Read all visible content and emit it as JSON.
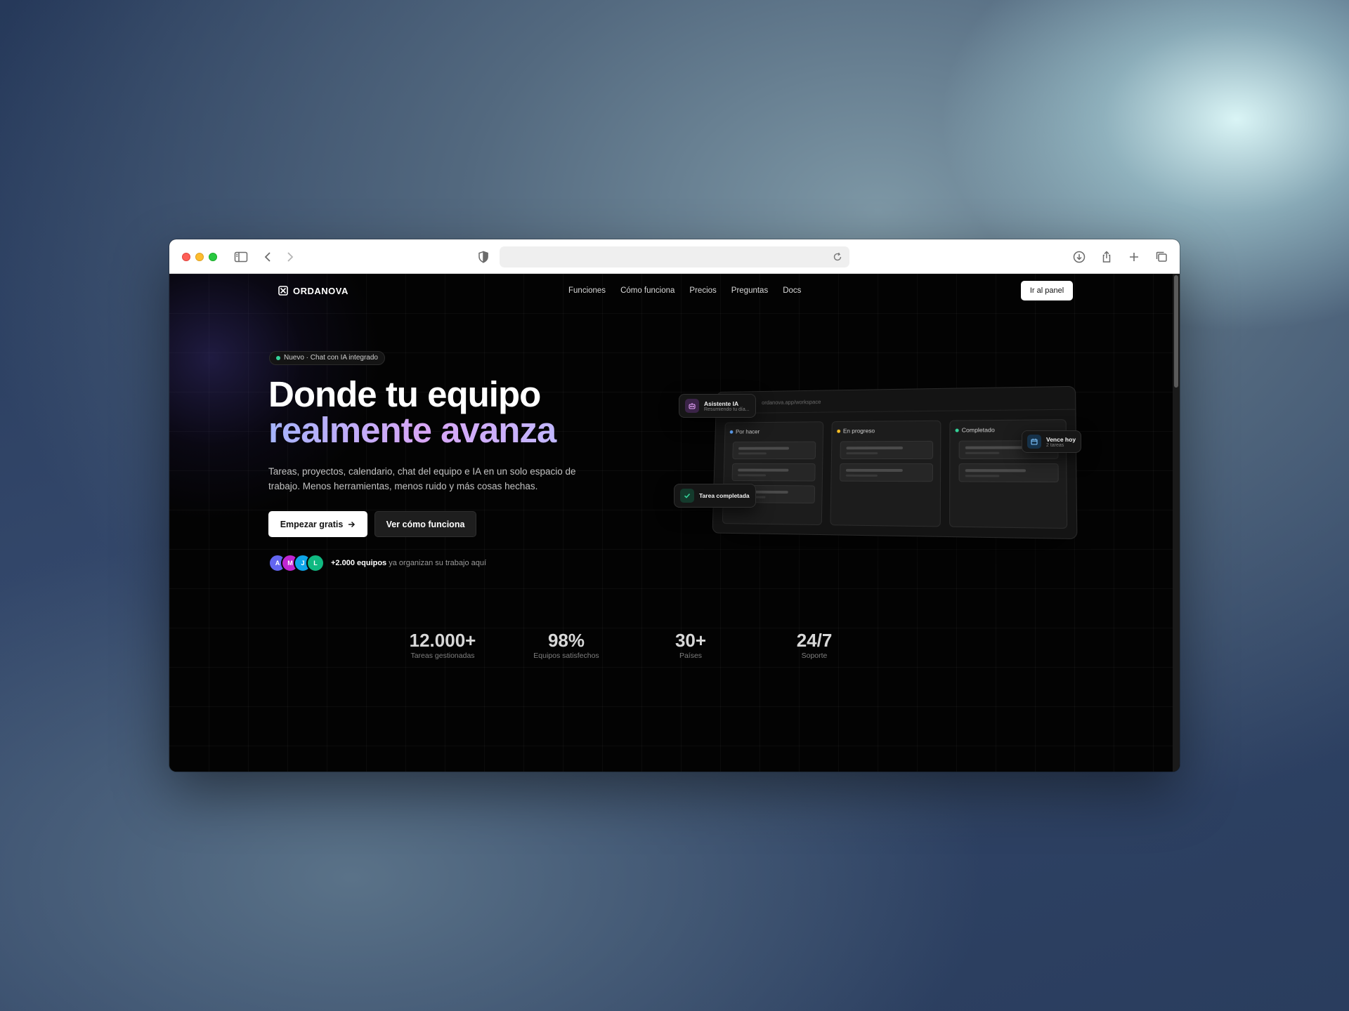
{
  "browser": {
    "url": "",
    "colors": {
      "close": "#fe5f57",
      "minimize": "#febc2e",
      "zoom": "#28c840"
    }
  },
  "nav": {
    "logo": "ORDANOVA",
    "links": [
      "Funciones",
      "Cómo funciona",
      "Precios",
      "Preguntas",
      "Docs"
    ],
    "cta": "Ir al panel"
  },
  "hero": {
    "badge": "Nuevo · Chat con IA integrado",
    "title_line1": "Donde tu equipo",
    "title_line2": "realmente avanza",
    "subtitle": "Tareas, proyectos, calendario, chat del equipo e IA en un solo espacio de trabajo. Menos herramientas, menos ruido y más cosas hechas.",
    "primary_cta": "Empezar gratis",
    "secondary_cta": "Ver cómo funciona",
    "avatars": [
      {
        "initial": "A",
        "color": "#6366f1"
      },
      {
        "initial": "M",
        "color": "#c026d3"
      },
      {
        "initial": "J",
        "color": "#0ea5e9"
      },
      {
        "initial": "L",
        "color": "#10b981"
      }
    ],
    "social_bold": "+2.000 equipos",
    "social_rest": " ya organizan su trabajo aquí"
  },
  "mockup": {
    "url": "ordanova.app/workspace",
    "columns": [
      {
        "title": "Por hacer",
        "dot": "#60a5fa"
      },
      {
        "title": "En progreso",
        "dot": "#fbbf24"
      },
      {
        "title": "Completado",
        "dot": "#34d399"
      }
    ],
    "assistant_title": "Asistente IA",
    "assistant_sub": "Resumiendo tu día...",
    "task_done": "Tarea completada",
    "due_title": "Vence hoy",
    "due_sub": "2 tareas"
  },
  "stats": [
    {
      "value": "12.000+",
      "label": "Tareas gestionadas"
    },
    {
      "value": "98%",
      "label": "Equipos satisfechos"
    },
    {
      "value": "30+",
      "label": "Países"
    },
    {
      "value": "24/7",
      "label": "Soporte"
    }
  ]
}
